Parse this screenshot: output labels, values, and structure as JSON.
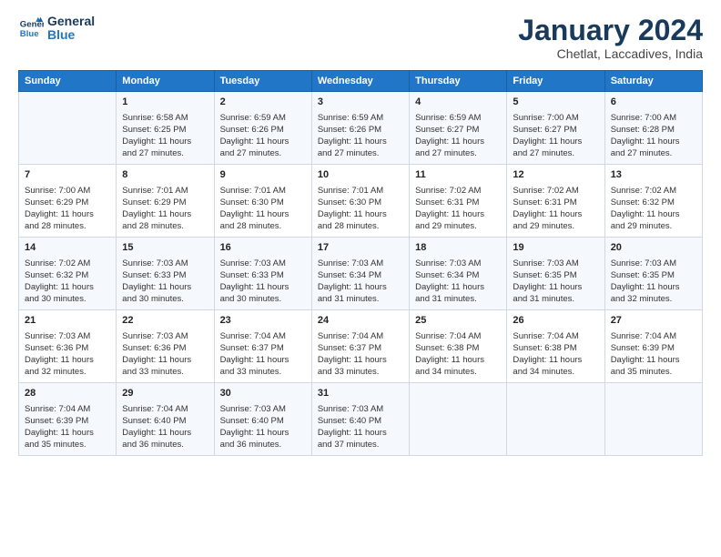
{
  "logo": {
    "line1": "General",
    "line2": "Blue"
  },
  "title": "January 2024",
  "subtitle": "Chetlat, Laccadives, India",
  "days_header": [
    "Sunday",
    "Monday",
    "Tuesday",
    "Wednesday",
    "Thursday",
    "Friday",
    "Saturday"
  ],
  "weeks": [
    [
      {
        "num": "",
        "info": ""
      },
      {
        "num": "1",
        "info": "Sunrise: 6:58 AM\nSunset: 6:25 PM\nDaylight: 11 hours\nand 27 minutes."
      },
      {
        "num": "2",
        "info": "Sunrise: 6:59 AM\nSunset: 6:26 PM\nDaylight: 11 hours\nand 27 minutes."
      },
      {
        "num": "3",
        "info": "Sunrise: 6:59 AM\nSunset: 6:26 PM\nDaylight: 11 hours\nand 27 minutes."
      },
      {
        "num": "4",
        "info": "Sunrise: 6:59 AM\nSunset: 6:27 PM\nDaylight: 11 hours\nand 27 minutes."
      },
      {
        "num": "5",
        "info": "Sunrise: 7:00 AM\nSunset: 6:27 PM\nDaylight: 11 hours\nand 27 minutes."
      },
      {
        "num": "6",
        "info": "Sunrise: 7:00 AM\nSunset: 6:28 PM\nDaylight: 11 hours\nand 27 minutes."
      }
    ],
    [
      {
        "num": "7",
        "info": "Sunrise: 7:00 AM\nSunset: 6:29 PM\nDaylight: 11 hours\nand 28 minutes."
      },
      {
        "num": "8",
        "info": "Sunrise: 7:01 AM\nSunset: 6:29 PM\nDaylight: 11 hours\nand 28 minutes."
      },
      {
        "num": "9",
        "info": "Sunrise: 7:01 AM\nSunset: 6:30 PM\nDaylight: 11 hours\nand 28 minutes."
      },
      {
        "num": "10",
        "info": "Sunrise: 7:01 AM\nSunset: 6:30 PM\nDaylight: 11 hours\nand 28 minutes."
      },
      {
        "num": "11",
        "info": "Sunrise: 7:02 AM\nSunset: 6:31 PM\nDaylight: 11 hours\nand 29 minutes."
      },
      {
        "num": "12",
        "info": "Sunrise: 7:02 AM\nSunset: 6:31 PM\nDaylight: 11 hours\nand 29 minutes."
      },
      {
        "num": "13",
        "info": "Sunrise: 7:02 AM\nSunset: 6:32 PM\nDaylight: 11 hours\nand 29 minutes."
      }
    ],
    [
      {
        "num": "14",
        "info": "Sunrise: 7:02 AM\nSunset: 6:32 PM\nDaylight: 11 hours\nand 30 minutes."
      },
      {
        "num": "15",
        "info": "Sunrise: 7:03 AM\nSunset: 6:33 PM\nDaylight: 11 hours\nand 30 minutes."
      },
      {
        "num": "16",
        "info": "Sunrise: 7:03 AM\nSunset: 6:33 PM\nDaylight: 11 hours\nand 30 minutes."
      },
      {
        "num": "17",
        "info": "Sunrise: 7:03 AM\nSunset: 6:34 PM\nDaylight: 11 hours\nand 31 minutes."
      },
      {
        "num": "18",
        "info": "Sunrise: 7:03 AM\nSunset: 6:34 PM\nDaylight: 11 hours\nand 31 minutes."
      },
      {
        "num": "19",
        "info": "Sunrise: 7:03 AM\nSunset: 6:35 PM\nDaylight: 11 hours\nand 31 minutes."
      },
      {
        "num": "20",
        "info": "Sunrise: 7:03 AM\nSunset: 6:35 PM\nDaylight: 11 hours\nand 32 minutes."
      }
    ],
    [
      {
        "num": "21",
        "info": "Sunrise: 7:03 AM\nSunset: 6:36 PM\nDaylight: 11 hours\nand 32 minutes."
      },
      {
        "num": "22",
        "info": "Sunrise: 7:03 AM\nSunset: 6:36 PM\nDaylight: 11 hours\nand 33 minutes."
      },
      {
        "num": "23",
        "info": "Sunrise: 7:04 AM\nSunset: 6:37 PM\nDaylight: 11 hours\nand 33 minutes."
      },
      {
        "num": "24",
        "info": "Sunrise: 7:04 AM\nSunset: 6:37 PM\nDaylight: 11 hours\nand 33 minutes."
      },
      {
        "num": "25",
        "info": "Sunrise: 7:04 AM\nSunset: 6:38 PM\nDaylight: 11 hours\nand 34 minutes."
      },
      {
        "num": "26",
        "info": "Sunrise: 7:04 AM\nSunset: 6:38 PM\nDaylight: 11 hours\nand 34 minutes."
      },
      {
        "num": "27",
        "info": "Sunrise: 7:04 AM\nSunset: 6:39 PM\nDaylight: 11 hours\nand 35 minutes."
      }
    ],
    [
      {
        "num": "28",
        "info": "Sunrise: 7:04 AM\nSunset: 6:39 PM\nDaylight: 11 hours\nand 35 minutes."
      },
      {
        "num": "29",
        "info": "Sunrise: 7:04 AM\nSunset: 6:40 PM\nDaylight: 11 hours\nand 36 minutes."
      },
      {
        "num": "30",
        "info": "Sunrise: 7:03 AM\nSunset: 6:40 PM\nDaylight: 11 hours\nand 36 minutes."
      },
      {
        "num": "31",
        "info": "Sunrise: 7:03 AM\nSunset: 6:40 PM\nDaylight: 11 hours\nand 37 minutes."
      },
      {
        "num": "",
        "info": ""
      },
      {
        "num": "",
        "info": ""
      },
      {
        "num": "",
        "info": ""
      }
    ]
  ]
}
